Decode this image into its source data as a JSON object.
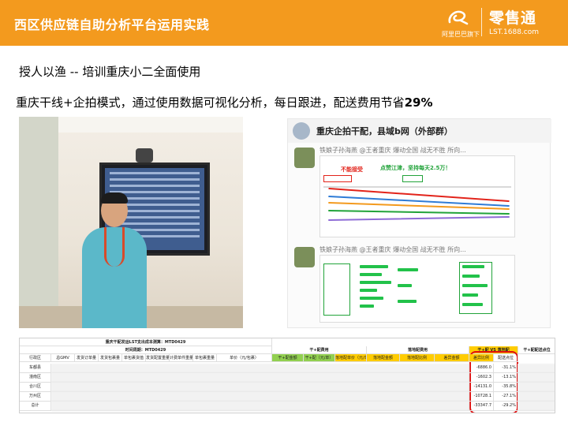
{
  "header": {
    "title": "西区供应链自助分析平台运用实践",
    "logo_cn": "阿里巴巴旗下",
    "logo_brand": "零售通",
    "logo_url": "LST.1688.com",
    "bg": "#f39a1e"
  },
  "subtitle": "授人以渔 -- 培训重庆小二全面使用",
  "statement": {
    "text": "重庆干线+企拍模式，通过使用数据可视化分析，每日跟进，配送费用节省",
    "highlight": "29%"
  },
  "chat": {
    "title": "重庆企拍干配，县域b网（外部群）",
    "msg1_name": "铁娘子孙海燕 @王者重庆 爆动全国 战无不胜 所向...",
    "msg2_name": "铁娘子孙海燕 @王者重庆 爆动全国 战无不胜 所向...",
    "callout_red": "不能接受",
    "callout_green": "点赞江津，坚持每天2.5万！"
  },
  "table": {
    "title": "重庆干配发运LST支出成本测算：MTD0429",
    "period": "时间周期：MTD0429",
    "groups": [
      "干+配费用",
      "落地配费用",
      "干+配 VS 落地配",
      "干+配配送点位"
    ],
    "headers": [
      "行政区",
      "总GMV",
      "发货订单量",
      "发货包裹量",
      "单包裹货值",
      "发货配置重量",
      "计费单件重量",
      "单包裹重量",
      "单价（元/包裹）",
      "干+配金额",
      "干+配（元/单）",
      "落地配单价（元/单）",
      "落地配金额",
      "落地配比例",
      "差异金额",
      "差异比例",
      "配送点位"
    ],
    "rows": [
      {
        "name": "车都县",
        "diff": "-6886.0",
        "pct": "-31.1%"
      },
      {
        "name": "潼南区",
        "diff": "-1602.3",
        "pct": "-13.1%"
      },
      {
        "name": "合川区",
        "diff": "-14131.0",
        "pct": "-35.8%"
      },
      {
        "name": "万州区",
        "diff": "-10728.1",
        "pct": "-27.1%"
      },
      {
        "name": "总计",
        "diff": "-33347.7",
        "pct": "-29.2%"
      }
    ]
  },
  "colors": {
    "accent": "#f39a1e",
    "highlight_red": "#e01010",
    "yellow": "#ffcc00",
    "green": "#92d050"
  }
}
